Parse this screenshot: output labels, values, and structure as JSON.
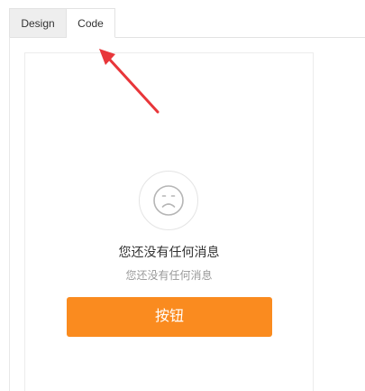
{
  "tabs": [
    {
      "label": "Design"
    },
    {
      "label": "Code"
    }
  ],
  "empty_state": {
    "icon": "sad-face-icon",
    "title": "您还没有任何消息",
    "subtitle": "您还没有任何消息",
    "button_label": "按钮"
  },
  "colors": {
    "accent": "#fa8b1f",
    "annotation": "#e8363a"
  }
}
